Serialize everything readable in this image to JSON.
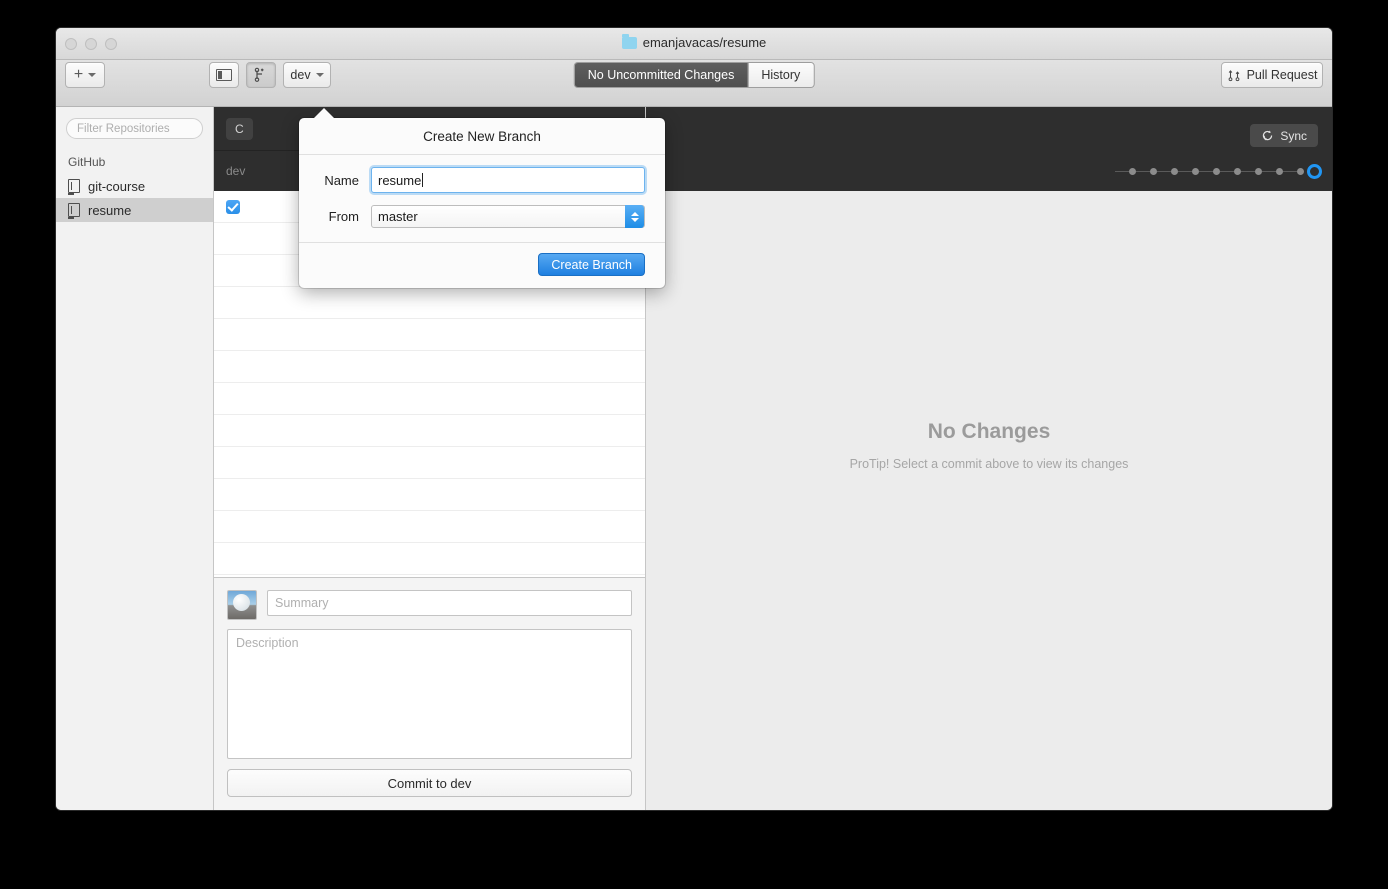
{
  "window": {
    "title": "emanjavacas/resume",
    "title_icon": "folder-icon"
  },
  "toolbar": {
    "add_label": "+",
    "add_icon": "plus-icon",
    "sidebar_icon": "sidebar-toggle-icon",
    "branch_icon": "create-branch-icon",
    "branch_button_label": "dev",
    "pull_request_label": "Pull Request",
    "pull_request_icon": "pull-request-icon",
    "segments": [
      {
        "label": "No Uncommitted Changes",
        "active": true
      },
      {
        "label": "History",
        "active": false
      }
    ]
  },
  "sidebar": {
    "filter_placeholder": "Filter Repositories",
    "group_label": "GitHub",
    "items": [
      {
        "label": "git-course",
        "icon": "repository-icon",
        "selected": false
      },
      {
        "label": "resume",
        "icon": "repository-icon",
        "selected": true
      }
    ]
  },
  "changes_pane": {
    "header_pill": "C",
    "branch_label": "dev",
    "file_rows": 12,
    "checked_row_index": 0,
    "commit": {
      "avatar": "user-avatar",
      "summary_placeholder": "Summary",
      "description_placeholder": "Description",
      "commit_button_label": "Commit to dev"
    }
  },
  "right_pane": {
    "sync_label": "Sync",
    "sync_icon": "refresh-icon",
    "empty_title": "No Changes",
    "empty_subtitle": "ProTip! Select a commit above to view its changes",
    "graph": {
      "dot_count": 9,
      "head_color": "#2196f3",
      "dot_color": "#8c8c8c"
    }
  },
  "popover": {
    "title": "Create New Branch",
    "name_label": "Name",
    "name_value": "resume",
    "from_label": "From",
    "from_value": "master",
    "create_label": "Create Branch",
    "accent_color": "#1e7fe0"
  }
}
